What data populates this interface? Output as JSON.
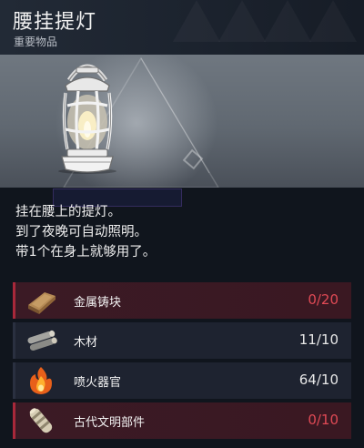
{
  "item": {
    "title": "腰挂提灯",
    "category": "重要物品",
    "icon": "lantern-icon"
  },
  "description": [
    "挂在腰上的提灯。",
    "到了夜晚可自动照明。",
    "带1个在身上就够用了。"
  ],
  "materials": [
    {
      "name": "金属铸块",
      "owned": 0,
      "required": 20,
      "count_text": "0/20",
      "sufficient": false,
      "icon": "metal-ingot-icon"
    },
    {
      "name": "木材",
      "owned": 11,
      "required": 10,
      "count_text": "11/10",
      "sufficient": true,
      "icon": "wood-icon"
    },
    {
      "name": "喷火器官",
      "owned": 64,
      "required": 10,
      "count_text": "64/10",
      "sufficient": true,
      "icon": "flame-organ-icon"
    },
    {
      "name": "古代文明部件",
      "owned": 0,
      "required": 10,
      "count_text": "0/10",
      "sufficient": false,
      "icon": "ancient-part-icon"
    }
  ],
  "colors": {
    "insufficient": "#e04a55",
    "insufficient_bg": "#3b1a25",
    "row_bg": "#1e2330"
  }
}
